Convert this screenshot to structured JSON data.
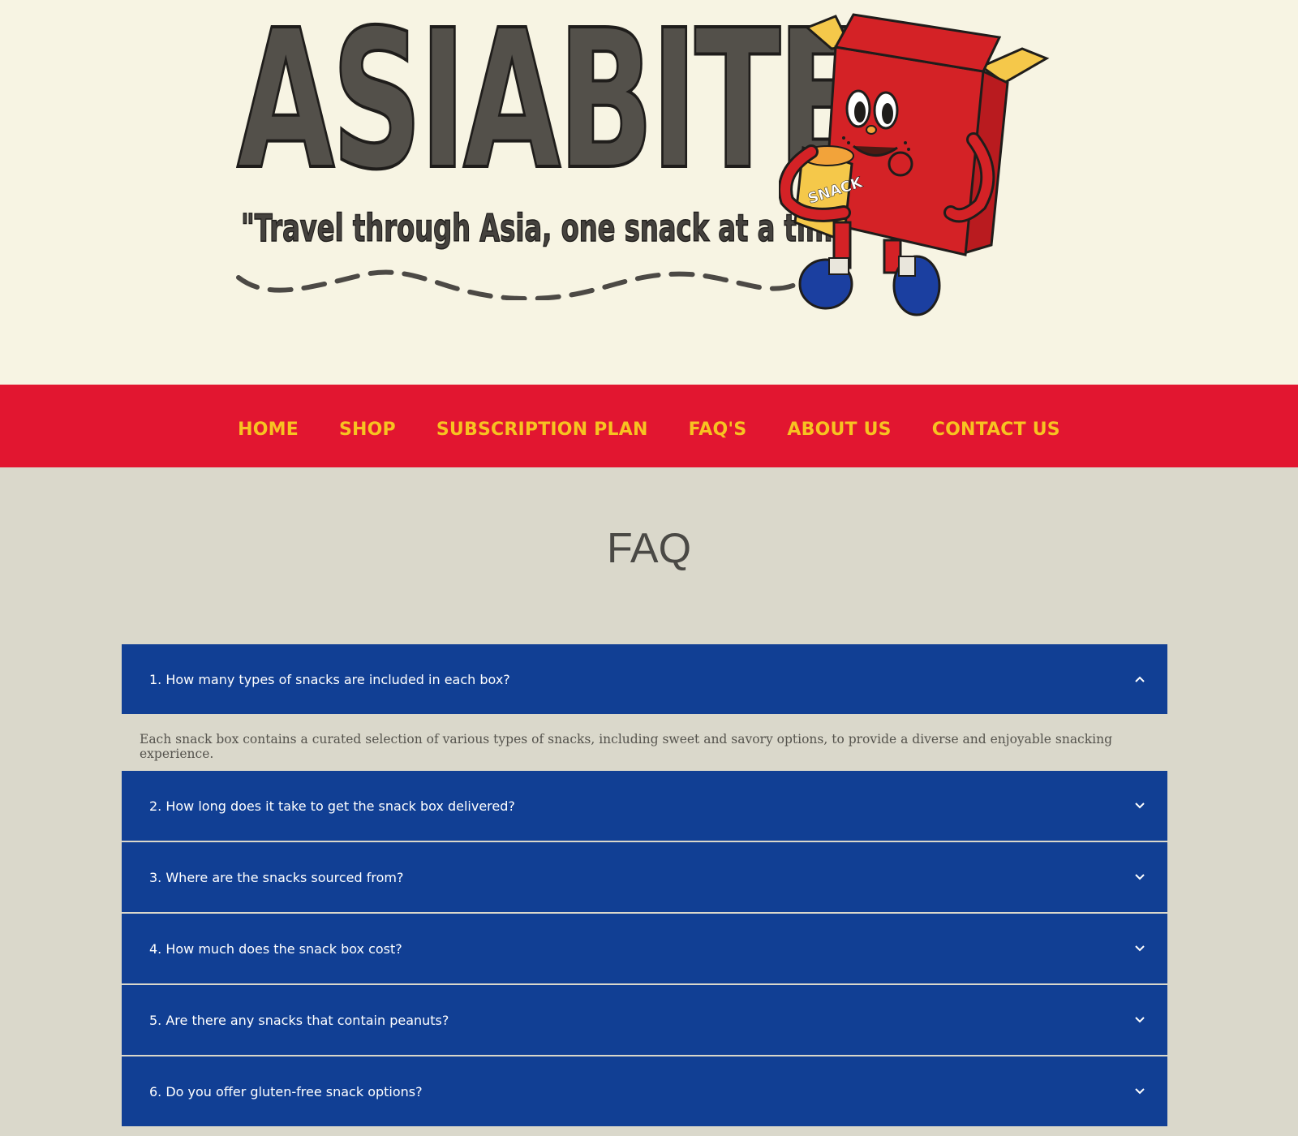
{
  "brand": {
    "name": "ASIABITE",
    "tagline": "\"Travel through Asia, one snack at a time\"",
    "mascot_bag_text": "SNACK"
  },
  "nav": {
    "items": [
      {
        "label": "HOME"
      },
      {
        "label": "SHOP"
      },
      {
        "label": "SUBSCRIPTION PLAN"
      },
      {
        "label": "FAQ'S"
      },
      {
        "label": "ABOUT US"
      },
      {
        "label": "CONTACT US"
      }
    ]
  },
  "faq": {
    "title": "FAQ",
    "items": [
      {
        "question": "1. How many types of snacks are included in each box?",
        "expanded": true,
        "answer": "Each snack box contains a curated selection of various types of snacks, including sweet and savory options, to provide a diverse and enjoyable snacking experience."
      },
      {
        "question": "2. How long does it take to get the snack box delivered?",
        "expanded": false
      },
      {
        "question": "3. Where are the snacks sourced from?",
        "expanded": false
      },
      {
        "question": "4. How much does the snack box cost?",
        "expanded": false
      },
      {
        "question": "5. Are there any snacks that contain peanuts?",
        "expanded": false
      },
      {
        "question": "6. Do you offer gluten-free snack options?",
        "expanded": false
      }
    ]
  },
  "colors": {
    "header_bg": "#f7f4e3",
    "nav_bg": "#e21630",
    "nav_text": "#f7c321",
    "page_bg": "#dad8cb",
    "faq_bg": "#113f94",
    "mascot_red": "#d42226",
    "mascot_yellow": "#f5c84a",
    "shoe_blue": "#1b3fa0"
  }
}
